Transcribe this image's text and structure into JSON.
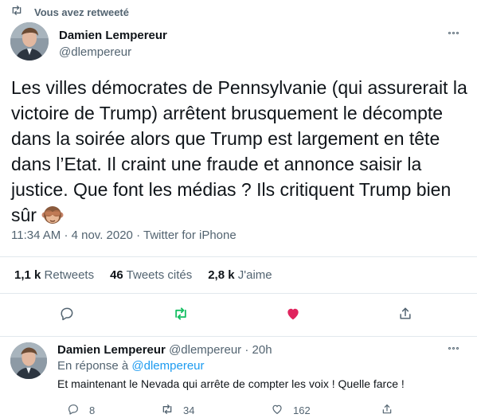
{
  "retweet_banner": {
    "text": "Vous avez retweeté",
    "icon": "retweet-icon"
  },
  "main_tweet": {
    "author_name": "Damien Lempereur",
    "author_handle": "@dlempereur",
    "text": "Les villes démocrates de Pennsylvanie (qui assurerait la\nvictoire de Trump) arrêtent brusquement le décompte\ndans la soirée alors que Trump est largement en tête\ndans l’Etat. Il craint une fraude et annonce saisir la\njustice. Que font les médias ? Ils critiquent Trump bien\nsûr",
    "emoji": "see-no-evil-monkey",
    "time": "11:34 AM",
    "date": "4 nov. 2020",
    "source": "Twitter for iPhone",
    "separator": "·",
    "stats": [
      {
        "value": "1,1 k",
        "label": "Retweets"
      },
      {
        "value": "46",
        "label": "Tweets cités"
      },
      {
        "value": "2,8 k",
        "label": "J'aime"
      }
    ],
    "actions": [
      {
        "name": "reply",
        "icon": "reply-icon"
      },
      {
        "name": "retweet",
        "icon": "retweet-icon",
        "active": true,
        "color": "#17bf63"
      },
      {
        "name": "like",
        "icon": "heart-icon",
        "active": true,
        "color": "#e0245e"
      },
      {
        "name": "share",
        "icon": "share-icon"
      }
    ]
  },
  "reply_tweet": {
    "author_name": "Damien Lempereur",
    "author_handle": "@dlempereur",
    "separator": "·",
    "age": "20h",
    "in_reply_prefix": "En réponse à",
    "in_reply_handle": "@dlempereur",
    "text": "Et maintenant le Nevada qui arrête de compter les voix ! Quelle farce !",
    "reply_count": "8",
    "retweet_count": "34",
    "like_count": "162"
  },
  "colors": {
    "accent": "#1d9bf0",
    "retweet_green": "#17bf63",
    "like_red": "#e0245e",
    "muted": "#536471"
  }
}
